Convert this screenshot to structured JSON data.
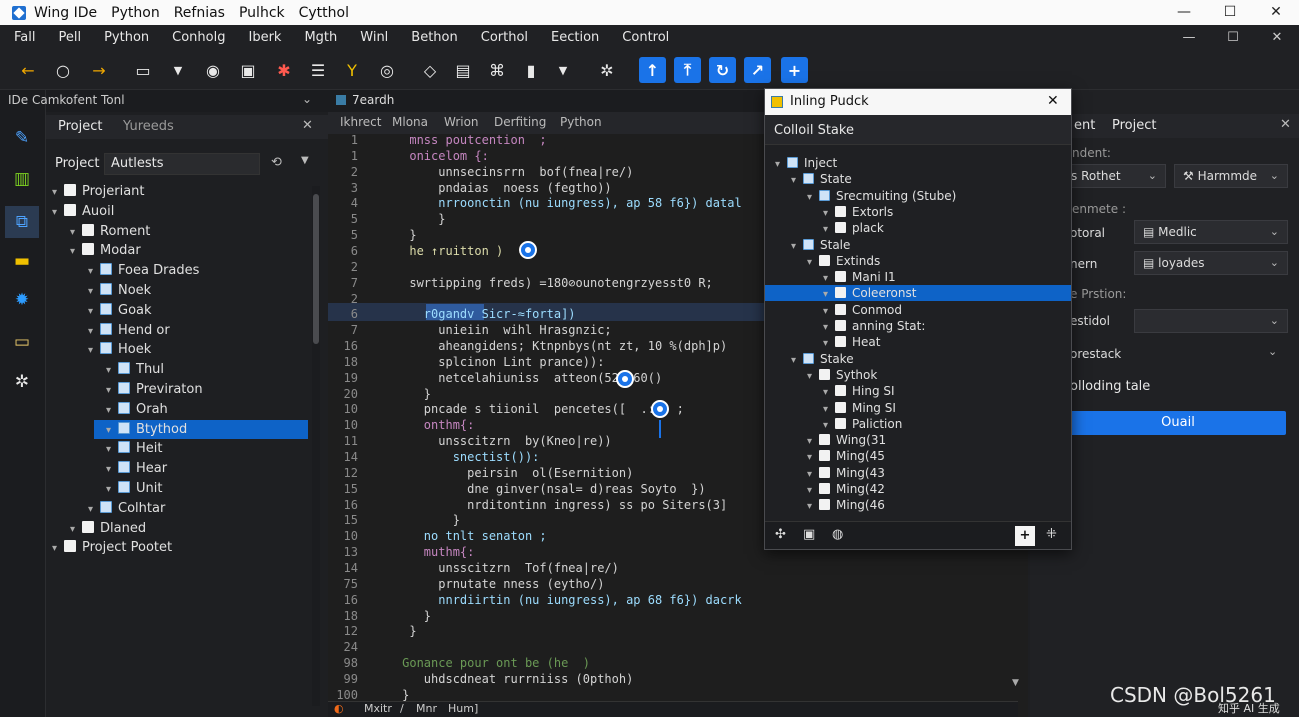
{
  "titlebar": {
    "items": [
      "Wing IDe",
      "Python",
      "Refnias",
      "Pulhck",
      "Cytthol"
    ],
    "minimize": "—",
    "maximize": "☐",
    "close": "✕"
  },
  "menubar": {
    "items": [
      "Fall",
      "Pell",
      "Python",
      "Conholg",
      "Iberk",
      "Mgth",
      "Winl",
      "Bethon",
      "Corthol",
      "Eection",
      "Control"
    ],
    "min": "—",
    "max": "☐",
    "close": "✕"
  },
  "toolbar": {
    "icons": [
      "arrow-left-icon",
      "circle-icon",
      "arrow-right-icon",
      "folder-icon",
      "chevron-down-icon",
      "stop-icon",
      "window-alert-icon",
      "debug-icon",
      "document-icon",
      "filter-icon",
      "target-icon",
      "tag-icon",
      "drive-icon",
      "network-icon",
      "save-icon",
      "chevron-down-icon",
      "settings-cluster-icon"
    ],
    "blue_buttons": [
      "step-up-icon",
      "step-into-icon",
      "refresh-icon",
      "step-over-icon",
      "add-icon"
    ]
  },
  "sidebar": {
    "header": "IDe Camkofent Tonl",
    "tabs": [
      "Project",
      "Yureeds"
    ],
    "search_label": "Project",
    "search_value": "Autlests",
    "tree": [
      {
        "label": "Projeriant",
        "level": 0,
        "chev": "▾"
      },
      {
        "label": "Auoil",
        "level": 0,
        "chev": "▾"
      },
      {
        "label": "Roment",
        "level": 1,
        "chev": "▾"
      },
      {
        "label": "Modar",
        "level": 1,
        "chev": "▾"
      },
      {
        "label": "Foea Drades",
        "level": 2,
        "chev": "▾"
      },
      {
        "label": "Noek",
        "level": 2,
        "chev": "▾"
      },
      {
        "label": "Goak",
        "level": 2,
        "chev": "▾"
      },
      {
        "label": "Hend or",
        "level": 2,
        "chev": "▾"
      },
      {
        "label": "Hoek",
        "level": 2,
        "chev": "▾"
      },
      {
        "label": "Thul",
        "level": 3,
        "chev": "▾"
      },
      {
        "label": "Previraton",
        "level": 3,
        "chev": "▾"
      },
      {
        "label": "Orah",
        "level": 3,
        "chev": "▾"
      },
      {
        "label": "Btythod",
        "level": 3,
        "chev": "▾",
        "selected": true
      },
      {
        "label": "Heit",
        "level": 3,
        "chev": "▾"
      },
      {
        "label": "Hear",
        "level": 3,
        "chev": "▾"
      },
      {
        "label": "Unit",
        "level": 3,
        "chev": "▾"
      },
      {
        "label": "Colhtar",
        "level": 2,
        "chev": "▾"
      },
      {
        "label": "Dlaned",
        "level": 1,
        "chev": "▾"
      },
      {
        "label": "Project Pootet",
        "level": 0,
        "chev": "▾"
      }
    ]
  },
  "editor": {
    "tab": "7eardh",
    "subtabs": [
      "Ikhrect",
      "Mlona",
      "Wrion",
      "Derfiting",
      "Python"
    ],
    "lines": [
      {
        "n": "1",
        "t": "      mnss poutcention  ;",
        "c": "#c586c0"
      },
      {
        "n": "1",
        "t": "      onicelom {:",
        "c": "#c586c0"
      },
      {
        "n": "2",
        "t": "          unnsecinsrrn  bof(fnea|re/)",
        "c": "#d4d4d4"
      },
      {
        "n": "3",
        "t": "          pndaias  noess (fegtho))",
        "c": "#d4d4d4"
      },
      {
        "n": "4",
        "t": "          nrroonctin (nu iungress), ap 58 f6}) datal",
        "c": "#9cdcfe"
      },
      {
        "n": "5",
        "t": "          }",
        "c": "#d4d4d4"
      },
      {
        "n": "5",
        "t": "      }",
        "c": "#d4d4d4"
      },
      {
        "n": "6",
        "t": "      he ↑ruitton )",
        "c": "#dcdcaa"
      },
      {
        "n": "2",
        "t": "",
        "c": "#d4d4d4"
      },
      {
        "n": "7",
        "t": "      swrtipping freds) =180⊘ounotengrzyesst0 R;",
        "c": "#d4d4d4"
      },
      {
        "n": "2",
        "t": "",
        "c": "#d4d4d4"
      },
      {
        "n": "6",
        "t": "        r0gandv Sicr-≈forta])",
        "c": "#9cdcfe"
      },
      {
        "n": "7",
        "t": "          unieiin  wihl Hrasgnzic;",
        "c": "#d4d4d4"
      },
      {
        "n": "16",
        "t": "          aheangidens; Ktnpnbys(nt zt, 10 %(dph]p)",
        "c": "#d4d4d4"
      },
      {
        "n": "18",
        "t": "          splcinon Lint prance)):",
        "c": "#d4d4d4"
      },
      {
        "n": "19",
        "t": "          netcelahiuniss  atteon(526860()",
        "c": "#d4d4d4"
      },
      {
        "n": "20",
        "t": "        }",
        "c": "#d4d4d4"
      },
      {
        "n": "10",
        "t": "        pncade s tiionil  pencetes([  .:)) ;",
        "c": "#d4d4d4"
      },
      {
        "n": "10",
        "t": "        onthm{:",
        "c": "#c586c0"
      },
      {
        "n": "11",
        "t": "          unsscitzrn  by(Kneo|re))",
        "c": "#d4d4d4"
      },
      {
        "n": "14",
        "t": "            snectist()):",
        "c": "#9cdcfe"
      },
      {
        "n": "12",
        "t": "              peirsin  ol(Esernition)",
        "c": "#d4d4d4"
      },
      {
        "n": "15",
        "t": "              dne ginver(nsal= d)reas Soyto  })",
        "c": "#d4d4d4"
      },
      {
        "n": "16",
        "t": "              nrditontinn ingress) ss po Siters(3]",
        "c": "#d4d4d4"
      },
      {
        "n": "15",
        "t": "            }",
        "c": "#d4d4d4"
      },
      {
        "n": "10",
        "t": "        no tnlt senaton ;",
        "c": "#9cdcfe"
      },
      {
        "n": "13",
        "t": "        muthm{:",
        "c": "#c586c0"
      },
      {
        "n": "14",
        "t": "          unsscitzrn  Tof(fnea|re/)",
        "c": "#d4d4d4"
      },
      {
        "n": "75",
        "t": "          prnutate nness (eytho/)",
        "c": "#d4d4d4"
      },
      {
        "n": "16",
        "t": "          nnrdiirtin (nu iungress), ap 68 f6}) dacrk",
        "c": "#9cdcfe"
      },
      {
        "n": "18",
        "t": "        }",
        "c": "#d4d4d4"
      },
      {
        "n": "12",
        "t": "      }",
        "c": "#d4d4d4"
      },
      {
        "n": "24",
        "t": "",
        "c": "#d4d4d4"
      },
      {
        "n": "98",
        "t": "     Gonance pour ont be (he  )",
        "c": "#6a9955"
      },
      {
        "n": "99",
        "t": "        uhdscdneat rurrniiss (0pthoh)",
        "c": "#d4d4d4"
      },
      {
        "n": "100",
        "t": "     }",
        "c": "#d4d4d4"
      }
    ],
    "statusbar": [
      "Mxitr",
      "/",
      "Mnr",
      "Hum]"
    ]
  },
  "popup": {
    "title": "Inling Pudck",
    "subtitle": "Colloil Stake",
    "tree": [
      {
        "label": "Inject",
        "level": 0,
        "icon": "grid"
      },
      {
        "label": "State",
        "level": 1,
        "icon": "grid"
      },
      {
        "label": "Srecmuiting (Stube)",
        "level": 2,
        "icon": "grid"
      },
      {
        "label": "Extorls",
        "level": 3,
        "icon": "box"
      },
      {
        "label": "plack",
        "level": 3,
        "icon": "box"
      },
      {
        "label": "Stale",
        "level": 1,
        "icon": "grid"
      },
      {
        "label": "Extinds",
        "level": 2,
        "icon": "box"
      },
      {
        "label": "Mani I1",
        "level": 3,
        "icon": "box"
      },
      {
        "label": "Coleeronst",
        "level": 3,
        "icon": "box",
        "selected": true
      },
      {
        "label": "Conmod",
        "level": 3,
        "icon": "box"
      },
      {
        "label": "anning Stat:",
        "level": 3,
        "icon": "box"
      },
      {
        "label": "Heat",
        "level": 3,
        "icon": "box"
      },
      {
        "label": "Stake",
        "level": 1,
        "icon": "grid"
      },
      {
        "label": "Sythok",
        "level": 2,
        "icon": "box"
      },
      {
        "label": "Hing SI",
        "level": 3,
        "icon": "box"
      },
      {
        "label": "Ming SI",
        "level": 3,
        "icon": "box"
      },
      {
        "label": "Paliction",
        "level": 3,
        "icon": "box"
      },
      {
        "label": "Wing(31",
        "level": 2,
        "icon": "box"
      },
      {
        "label": "Ming(45",
        "level": 2,
        "icon": "box"
      },
      {
        "label": "Ming(43",
        "level": 2,
        "icon": "box"
      },
      {
        "label": "Ming(42",
        "level": 2,
        "icon": "box"
      },
      {
        "label": "Ming(46",
        "level": 2,
        "icon": "box"
      }
    ],
    "close": "✕"
  },
  "rightpanel": {
    "tabs": [
      "ent",
      "Project"
    ],
    "fields": [
      {
        "label": "ndent:",
        "a": "s Rothet",
        "b": "Harmmde"
      },
      {
        "label": "enmete :",
        "a": "otoral",
        "b": "Medlic"
      },
      {
        "label": "",
        "a": "nern",
        "b": "loyades"
      },
      {
        "label": "e Prstion:",
        "a": "",
        "b": ""
      },
      {
        "label": "",
        "a": "estidol",
        "b": ""
      },
      {
        "label": "",
        "a": "orestack",
        "b": ""
      }
    ],
    "section": "olloding tale",
    "button": "Ouail"
  },
  "watermark": {
    "main": "CSDN @Bol5261",
    "small": "知乎 AI 生成"
  },
  "colors": {
    "accent": "#1a73e8",
    "selection": "#0e63c7",
    "bg": "#1e1f22"
  }
}
